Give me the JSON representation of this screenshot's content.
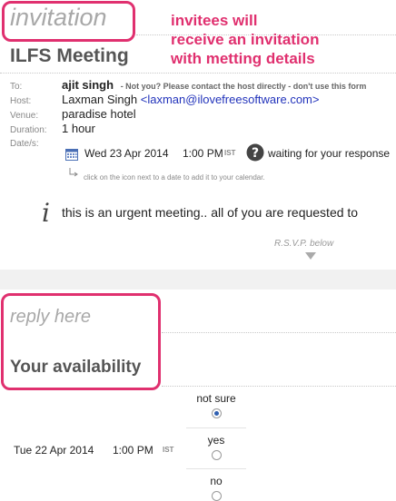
{
  "invitation": {
    "section_title": "invitation",
    "callout_lines": [
      "invitees will",
      "receive an invitation",
      "with metting details"
    ],
    "meeting_title": "ILFS Meeting",
    "to_label": "To:",
    "to_value": "ajit singh",
    "to_note": "- Not you? Please contact the host directly - don't use this form",
    "host_label": "Host:",
    "host_name": "Laxman Singh",
    "host_email": "<laxman@ilovefreesoftware.com>",
    "venue_label": "Venue:",
    "venue_value": "paradise hotel",
    "duration_label": "Duration:",
    "duration_value": "1 hour",
    "dates_label": "Date/s:",
    "date_value": "Wed 23 Apr 2014",
    "time_value": "1:00 PM",
    "tz": "IST",
    "status": "waiting for your response",
    "calendar_hint": "click on the icon next to a date to add it to your calendar.",
    "message": "this is an urgent meeting.. all of you are requested to",
    "rsvp": "R.S.V.P. below"
  },
  "reply": {
    "section_title": "reply here",
    "heading": "Your availability",
    "date_value": "Tue 22 Apr 2014",
    "time_value": "1:00 PM",
    "tz": "IST",
    "options": [
      "not sure",
      "yes",
      "no"
    ],
    "selected": "not sure"
  }
}
